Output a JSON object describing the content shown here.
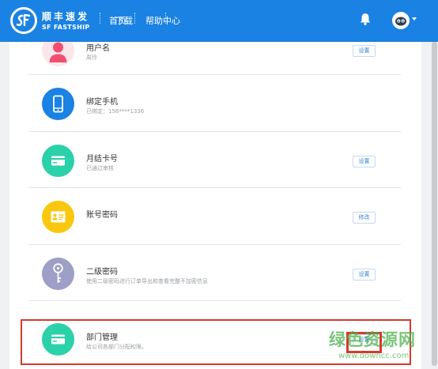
{
  "brand": {
    "name_cn": "顺丰速发",
    "name_en": "SF FASTSHIP",
    "color": "#1a82e2"
  },
  "nav": [
    {
      "label": "首页"
    },
    {
      "label": "下载"
    },
    {
      "label": "帮助中心"
    }
  ],
  "header_icons": {
    "notification": "bell-icon",
    "user": "avatar-icon",
    "menu": "chevron-down-icon"
  },
  "settings": [
    {
      "title": "用户名",
      "desc": "周玲",
      "button": "设置",
      "icon": "user-icon",
      "color": "#f0506e"
    },
    {
      "title": "绑定手机",
      "desc": "已绑定：156****1336",
      "button": "",
      "icon": "phone-icon",
      "color": "#1a82e2"
    },
    {
      "title": "月结卡号",
      "desc": "已通过审核",
      "button": "设置",
      "icon": "card-icon",
      "color": "#2bd1a8"
    },
    {
      "title": "账号密码",
      "desc": "",
      "button": "修改",
      "icon": "id-card-icon",
      "color": "#f9c80e"
    },
    {
      "title": "二级密码",
      "desc": "使用二级密码进行订单导出和查看完整不加密信息",
      "button": "设置",
      "icon": "key-icon",
      "color": "#9d9fc6"
    },
    {
      "title": "部门管理",
      "desc": "给公司各部门分配权限。",
      "button": "设置",
      "icon": "card-icon",
      "color": "#2bd1a8"
    }
  ],
  "highlight_color": "#d43a2e",
  "watermark": {
    "text": "绿色资源网",
    "url": "www.downcc.com"
  }
}
